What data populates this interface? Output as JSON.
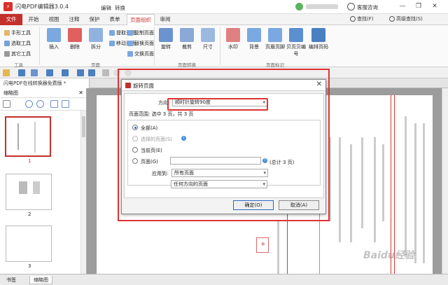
{
  "app": {
    "title": "闪电PDF编辑器3.0.4",
    "context_tabs": [
      "编辑",
      "转换"
    ],
    "client_label": "客服咨询",
    "window": {
      "minimize": "—",
      "restore": "❐",
      "close": "✕"
    }
  },
  "ribbon_tabs": [
    "文件",
    "开始",
    "视图",
    "注释",
    "保护",
    "表单",
    "页面组织",
    "审阅"
  ],
  "ribbon_active_tab": "页面组织",
  "ribbon_right": {
    "find": "查找(F)",
    "advanced_find": "高级查找(S)"
  },
  "ribbon": {
    "tools_group": {
      "label": "工具",
      "items": [
        "手形工具",
        "选取工具",
        "其它工具"
      ]
    },
    "pages_group": {
      "label": "页面",
      "insert": "插入",
      "delete": "删除",
      "split": "拆分",
      "small": [
        "提取页面",
        "移动页面",
        "复制页面",
        "替换页面",
        "交换页面"
      ]
    },
    "convert_group": {
      "label": "页面转换",
      "rotate": "旋转",
      "crop": "裁剪",
      "size": "尺寸"
    },
    "mark_group": {
      "label": "页面标记",
      "watermark": "水印",
      "background": "背景",
      "header_footer": "页眉页脚",
      "page_number": "贝页贝编号",
      "bates": "编排页码"
    }
  },
  "doc_tab": "闪电PDF在线转换器免费版 *",
  "left_panel": {
    "title": "缩略图",
    "close": "✕",
    "thumbnails": [
      "1",
      "2",
      "3"
    ],
    "bottom_tabs": [
      "书签",
      "缩略图"
    ]
  },
  "dialog": {
    "title": "旋转页面",
    "close": "✕",
    "direction_label": "方向:",
    "direction_value": "顺时针旋转90度",
    "range_header": "页面范围: 选中 3 页，共 3 页",
    "radio_all": "全部(A)",
    "radio_selected": "选择的页面(S)",
    "radio_current": "当前页(E)",
    "radio_pages": "页面(G)",
    "total_text": "(总计 3 页)",
    "apply_label": "应用到:",
    "apply_value": "所有页面",
    "orientation_value": "任何方向的页面",
    "ok": "确定(O)",
    "cancel": "取消(A)"
  },
  "watermark_text": "Baidu经验"
}
